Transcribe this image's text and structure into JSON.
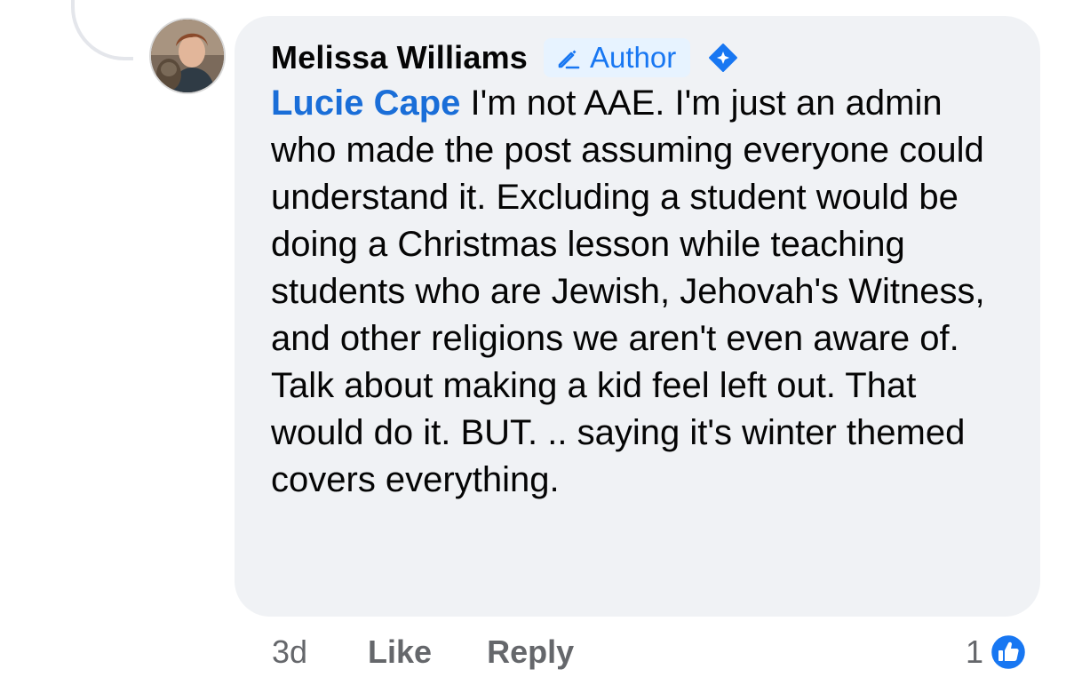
{
  "comment": {
    "author_name": "Melissa Williams",
    "author_badge": "Author",
    "mention": "Lucie Cape",
    "body": " I'm not AAE. I'm just an admin who made the post assuming everyone could understand it. Excluding a student would be doing a Christmas lesson while teaching students who are Jewish, Jehovah's Witness, and other religions we aren't even aware of. Talk about making a kid feel left out. That would do it. BUT. .. saying it's winter themed covers everything.",
    "timestamp": "3d",
    "like_label": "Like",
    "reply_label": "Reply",
    "reaction_count": "1"
  },
  "icons": {
    "badge": "pencil-icon",
    "verified": "diamond-badge-icon",
    "reaction": "like-reaction-icon"
  },
  "colors": {
    "bubble_bg": "#f0f2f5",
    "accent_blue": "#1877f2",
    "mention_blue": "#1a6ed8",
    "text": "#050505",
    "muted": "#65676b"
  }
}
